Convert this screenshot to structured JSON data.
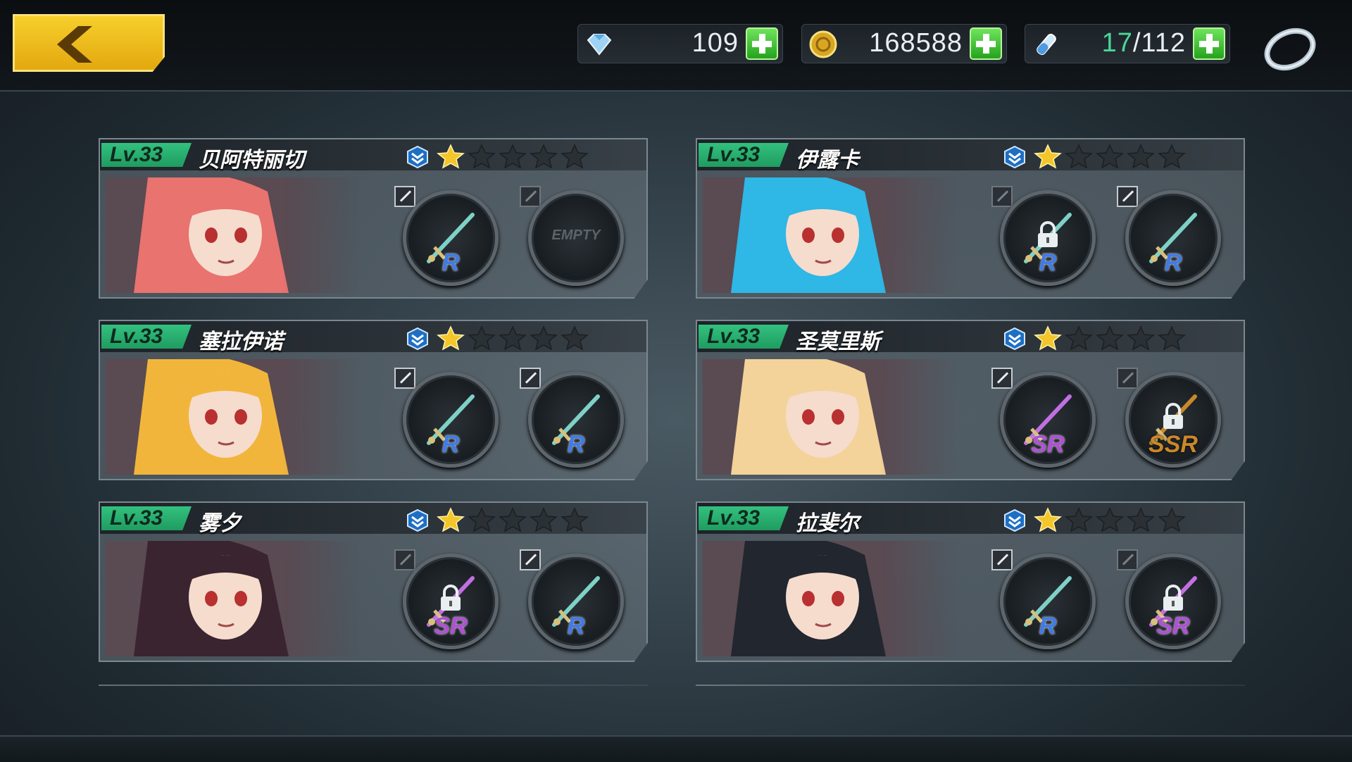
{
  "topbar": {
    "back_icon": "chevron-left-icon",
    "resources": [
      {
        "id": "diamond",
        "icon": "diamond-icon",
        "value": "109"
      },
      {
        "id": "gold",
        "icon": "gold-coin-icon",
        "value": "168588"
      },
      {
        "id": "stamina",
        "icon": "potion-vial-icon",
        "current": "17",
        "max": "/112"
      }
    ],
    "ring_icon": "ring-icon"
  },
  "colors": {
    "accent": "#f2c21e",
    "level_green": "#2bb873",
    "plus_green": "#3fc332",
    "star_gold": "#f3c629",
    "r": "#3f7be8",
    "sr": "#b14fd8",
    "ssr": "#c9882a"
  },
  "characters": [
    {
      "level": "Lv.33",
      "name": "贝阿特丽切",
      "stars": 1,
      "max_stars": 5,
      "hair": "#e8736f",
      "slots": [
        {
          "rarity": "R",
          "state": "equipped",
          "edit": true
        },
        {
          "rarity": "",
          "state": "empty",
          "label": "EMPTY",
          "edit": false
        }
      ]
    },
    {
      "level": "Lv.33",
      "name": "伊露卡",
      "stars": 1,
      "max_stars": 5,
      "hair": "#2fb7e6",
      "slots": [
        {
          "rarity": "R",
          "state": "locked",
          "edit": false
        },
        {
          "rarity": "R",
          "state": "equipped",
          "edit": true
        }
      ]
    },
    {
      "level": "Lv.33",
      "name": "塞拉伊诺",
      "stars": 1,
      "max_stars": 5,
      "hair": "#f2b53c",
      "slots": [
        {
          "rarity": "R",
          "state": "equipped",
          "edit": true
        },
        {
          "rarity": "R",
          "state": "equipped",
          "edit": true
        }
      ]
    },
    {
      "level": "Lv.33",
      "name": "圣莫里斯",
      "stars": 1,
      "max_stars": 5,
      "hair": "#f3d39a",
      "slots": [
        {
          "rarity": "SR",
          "state": "equipped",
          "edit": true
        },
        {
          "rarity": "SSR",
          "state": "locked",
          "edit": false
        }
      ]
    },
    {
      "level": "Lv.33",
      "name": "雾夕",
      "stars": 1,
      "max_stars": 5,
      "hair": "#3a2430",
      "slots": [
        {
          "rarity": "SR",
          "state": "locked",
          "edit": false
        },
        {
          "rarity": "R",
          "state": "equipped",
          "edit": true
        }
      ]
    },
    {
      "level": "Lv.33",
      "name": "拉斐尔",
      "stars": 1,
      "max_stars": 5,
      "hair": "#22262e",
      "slots": [
        {
          "rarity": "R",
          "state": "equipped",
          "edit": true
        },
        {
          "rarity": "SR",
          "state": "locked",
          "edit": false
        }
      ]
    }
  ]
}
